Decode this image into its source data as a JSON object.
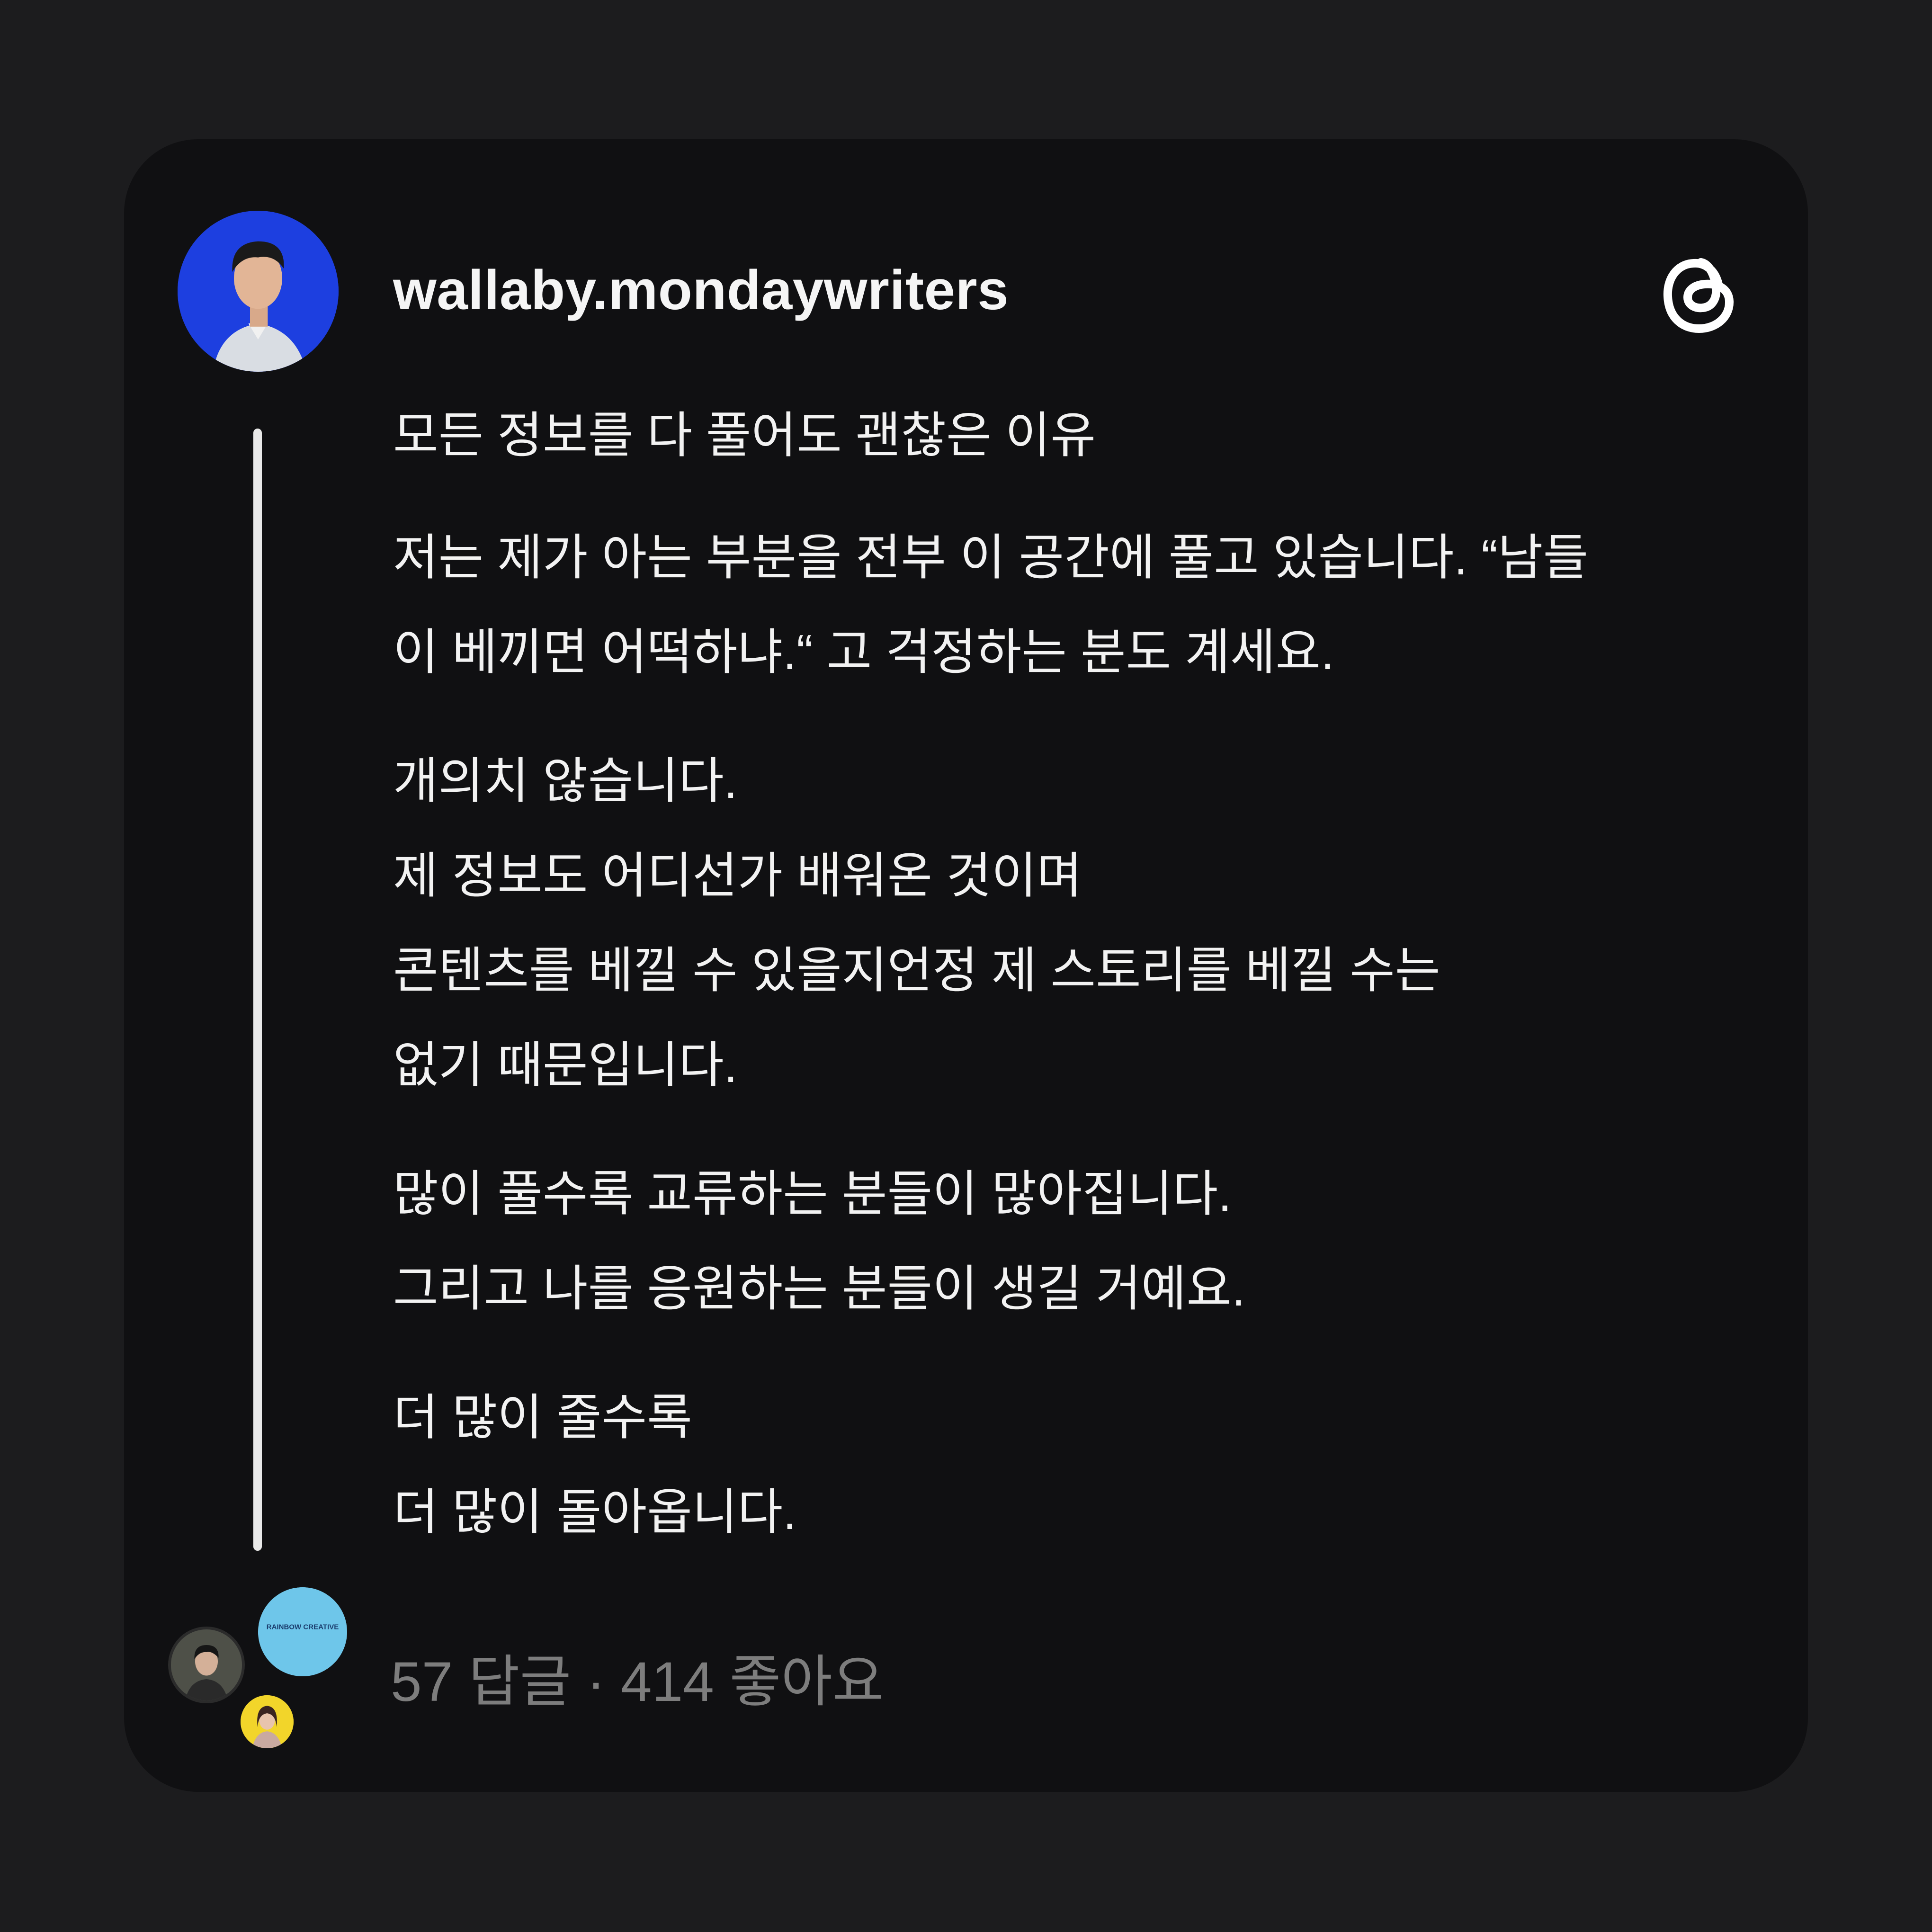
{
  "post": {
    "username": "wallaby.mondaywriters",
    "paragraphs": [
      [
        "모든 정보를 다 풀어도 괜찮은 이유"
      ],
      [
        "저는 제가 아는 부분을 전부 이 공간에 풀고 있습니다. “남들",
        "이 베끼면 어떡하냐.“ 고 걱정하는 분도 계세요."
      ],
      [
        "개의치 않습니다.",
        "제 정보도 어디선가 배워온 것이며",
        "콘텐츠를 베낄 수 있을지언정 제 스토리를 베낄 수는",
        "없기 때문입니다."
      ],
      [
        "많이 풀수록 교류하는 분들이 많아집니다.",
        "그리고 나를 응원하는 분들이 생길 거예요."
      ],
      [
        "더 많이 줄수록",
        "더 많이 돌아옵니다."
      ]
    ],
    "stats": "57 답글 · 414 좋아요",
    "reply_avatar_badge": "RAINBOW CREATIVE"
  },
  "icons": {
    "brand": "threads-logo-icon"
  },
  "colors": {
    "background": "#1c1c1e",
    "card": "#101012",
    "avatar_bg": "#1d3fe0",
    "text": "#f2f2f2",
    "muted": "#7d7d7d"
  }
}
